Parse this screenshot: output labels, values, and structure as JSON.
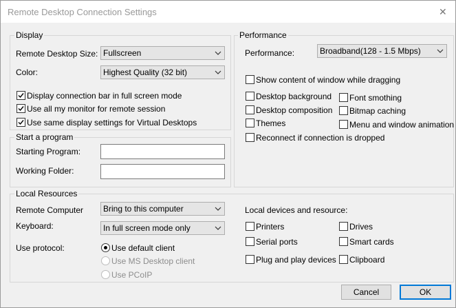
{
  "window": {
    "title": "Remote Desktop Connection Settings",
    "close_glyph": "✕"
  },
  "display": {
    "legend": "Display",
    "remote_size_label": "Remote Desktop Size:",
    "remote_size_value": "Fullscreen",
    "color_label": "Color:",
    "color_value": "Highest Quality (32 bit)",
    "checkboxes": [
      {
        "label": "Display connection bar in full screen mode",
        "checked": true
      },
      {
        "label": "Use all my monitor for remote session",
        "checked": true
      },
      {
        "label": "Use same display settings for Virtual Desktops",
        "checked": true
      }
    ]
  },
  "start_program": {
    "legend": "Start a program",
    "starting_program_label": "Starting Program:",
    "starting_program_value": "",
    "working_folder_label": "Working Folder:",
    "working_folder_value": ""
  },
  "performance": {
    "legend": "Performance",
    "performance_label": "Performance:",
    "performance_value": "Broadband(128 - 1.5 Mbps)",
    "show_content_label": "Show content of window while dragging",
    "options": {
      "desktop_background": "Desktop background",
      "desktop_composition": "Desktop composition",
      "themes": "Themes",
      "font_smoothing": "Font smothing",
      "bitmap_caching": "Bitmap caching",
      "menu_animation": "Menu and window animation",
      "reconnect": "Reconnect if connection is dropped"
    }
  },
  "local_resources": {
    "legend": "Local Resources",
    "remote_computer_label": "Remote Computer",
    "remote_computer_value": "Bring to this computer",
    "keyboard_label": "Keyboard:",
    "keyboard_value": "In full screen mode only",
    "protocol_label": "Use protocol:",
    "protocols": {
      "default_client": "Use default client",
      "ms_desktop_client": "Use MS Desktop client",
      "pcoip": "Use PCoIP"
    },
    "devices_label": "Local devices and resource:",
    "devices": {
      "printers": "Printers",
      "serial_ports": "Serial ports",
      "plug_and_play": "Plug and play devices",
      "drives": "Drives",
      "smart_cards": "Smart cards",
      "clipboard": "Clipboard"
    }
  },
  "buttons": {
    "cancel": "Cancel",
    "ok": "OK"
  }
}
